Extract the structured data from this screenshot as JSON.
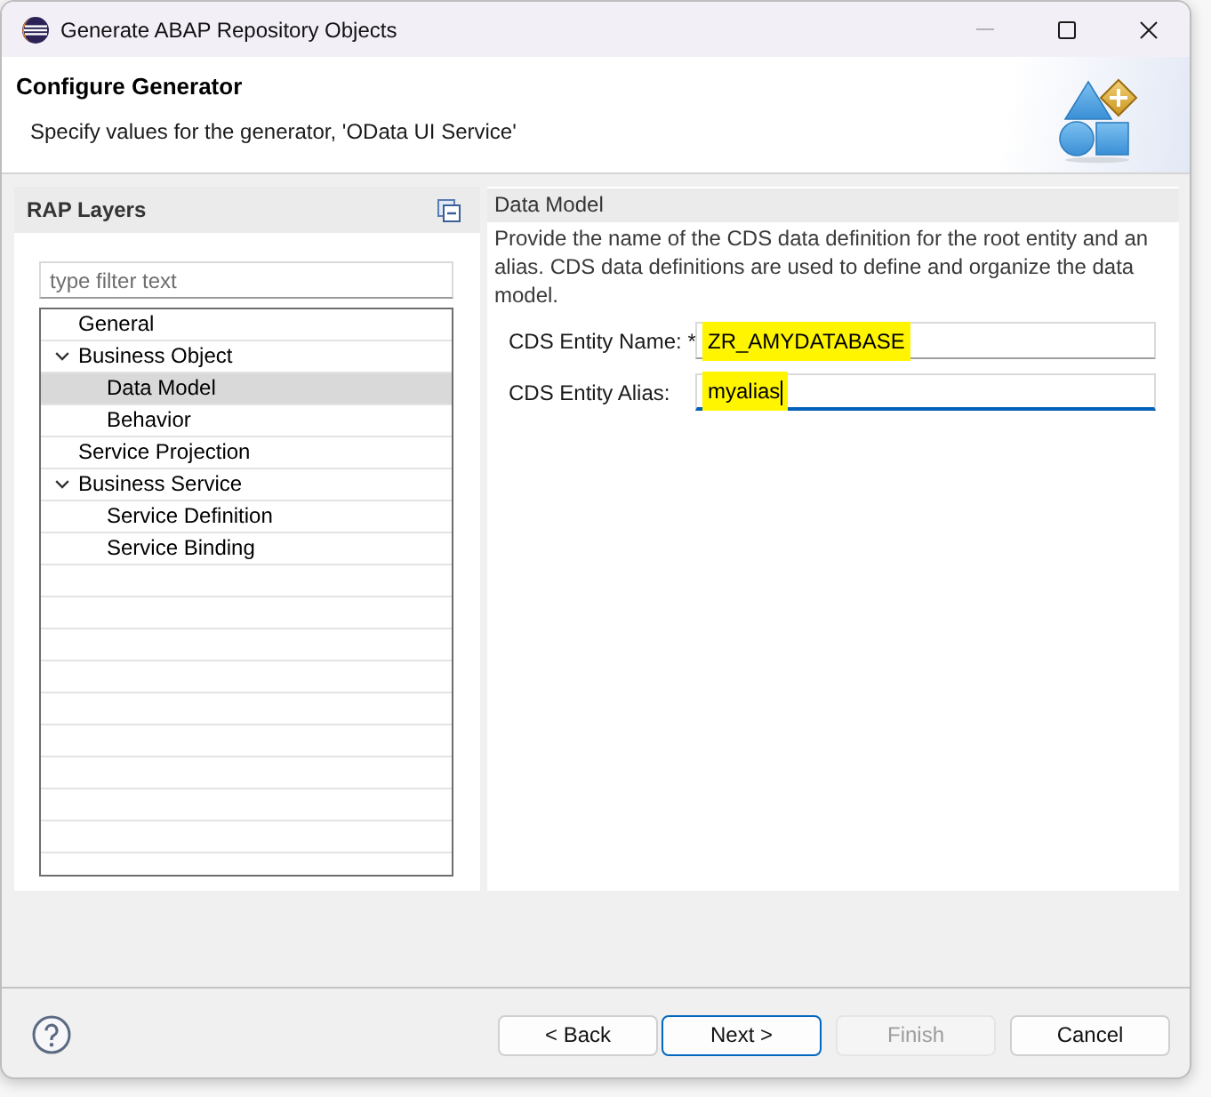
{
  "window": {
    "title": "Generate ABAP Repository Objects",
    "minimize_disabled": true
  },
  "header": {
    "title": "Configure Generator",
    "description": "Specify values for the generator, 'OData UI Service'"
  },
  "layers_panel": {
    "title": "RAP Layers",
    "filter": {
      "placeholder": "type filter text"
    },
    "tree": [
      {
        "label": "General",
        "selected": false
      },
      {
        "label": "Business Object",
        "selected": false,
        "expanded": true,
        "children": [
          {
            "label": "Data Model",
            "selected": true
          },
          {
            "label": "Behavior",
            "selected": false
          }
        ]
      },
      {
        "label": "Service Projection",
        "selected": false
      },
      {
        "label": "Business Service",
        "selected": false,
        "expanded": true,
        "children": [
          {
            "label": "Service Definition",
            "selected": false
          },
          {
            "label": "Service Binding",
            "selected": false
          }
        ]
      }
    ]
  },
  "section": {
    "title": "Data Model",
    "description": "Provide the name of the CDS data definition for the root entity and an alias. CDS data definitions are used to define and organize the data model.",
    "fields": [
      {
        "label": "CDS Entity Name: *",
        "value": "ZR_AMYDATABASE",
        "highlighted": true,
        "focused": false
      },
      {
        "label": "CDS Entity Alias:",
        "value": "myalias",
        "highlighted": true,
        "focused": true
      }
    ]
  },
  "buttons": [
    {
      "label": "< Back",
      "default": false,
      "disabled": false
    },
    {
      "label": "Next >",
      "default": true,
      "disabled": false
    },
    {
      "label": "Finish",
      "default": false,
      "disabled": true
    },
    {
      "label": "Cancel",
      "default": false,
      "disabled": false
    }
  ]
}
